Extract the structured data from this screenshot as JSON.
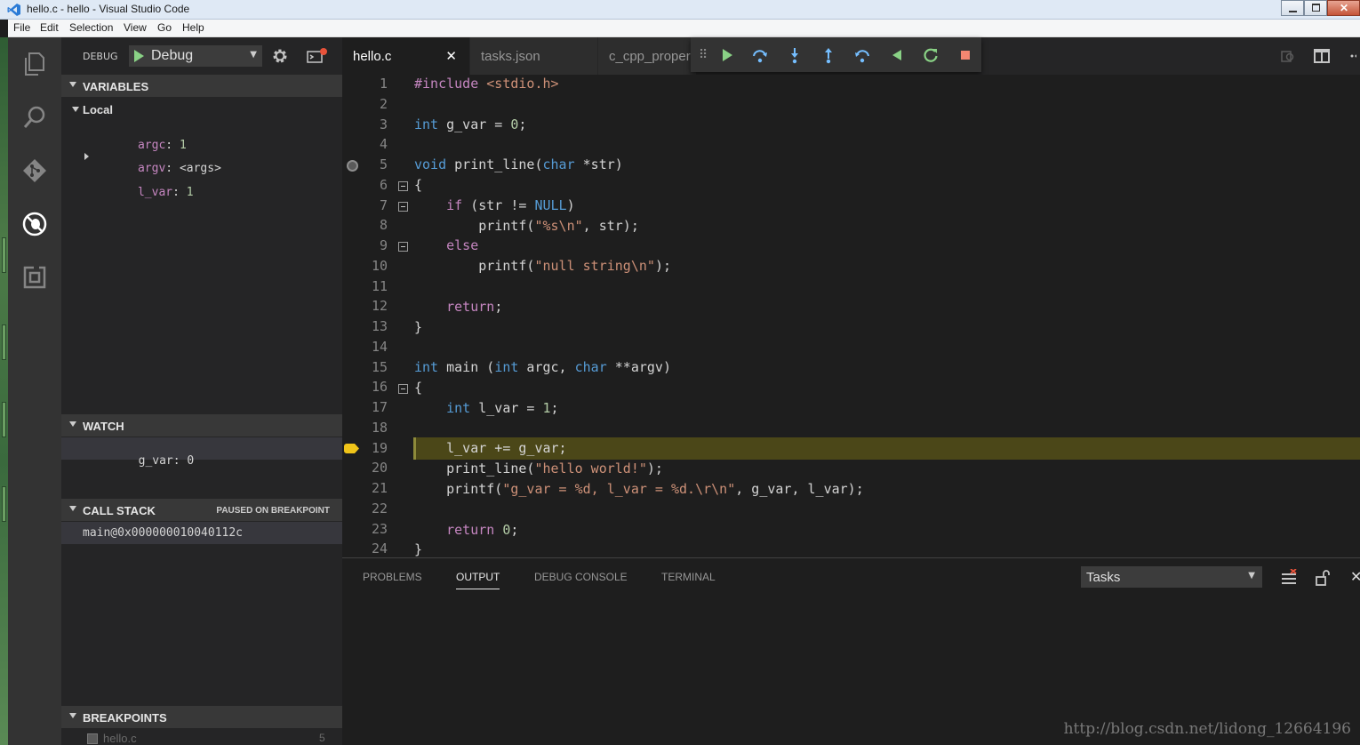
{
  "window": {
    "title": "hello.c - hello - Visual Studio Code"
  },
  "menu": [
    "File",
    "Edit",
    "Selection",
    "View",
    "Go",
    "Help"
  ],
  "activity_bar": [
    "files-icon",
    "search-icon",
    "git-icon",
    "debug-icon",
    "extensions-icon"
  ],
  "debug": {
    "label": "DEBUG",
    "config": "Debug"
  },
  "variables": {
    "title": "VARIABLES",
    "scope": "Local",
    "items": [
      {
        "name": "argc",
        "value": "1"
      },
      {
        "name": "argv",
        "value": "<args>"
      },
      {
        "name": "l_var",
        "value": "1"
      }
    ]
  },
  "watch": {
    "title": "WATCH",
    "items": [
      {
        "name": "g_var",
        "value": "0"
      }
    ]
  },
  "call_stack": {
    "title": "CALL STACK",
    "status": "PAUSED ON BREAKPOINT",
    "frames": [
      "main@0x000000010040112c"
    ]
  },
  "breakpoints": {
    "title": "BREAKPOINTS",
    "items": [
      {
        "file": "hello.c",
        "line": "5"
      }
    ]
  },
  "tabs": [
    {
      "label": "hello.c",
      "active": true
    },
    {
      "label": "tasks.json",
      "active": false
    },
    {
      "label": "c_cpp_proper",
      "active": false
    }
  ],
  "debug_toolbar": [
    "continue-icon",
    "step-over-icon",
    "step-into-icon",
    "step-out-icon",
    "step-back-icon",
    "reverse-continue-icon",
    "restart-icon",
    "stop-icon"
  ],
  "editor": {
    "current_line": 19,
    "breakpoint_line": 5,
    "lines": [
      {
        "n": "1"
      },
      {
        "n": "2"
      },
      {
        "n": "3"
      },
      {
        "n": "4"
      },
      {
        "n": "5"
      },
      {
        "n": "6"
      },
      {
        "n": "7"
      },
      {
        "n": "8"
      },
      {
        "n": "9"
      },
      {
        "n": "10"
      },
      {
        "n": "11"
      },
      {
        "n": "12"
      },
      {
        "n": "13"
      },
      {
        "n": "14"
      },
      {
        "n": "15"
      },
      {
        "n": "16"
      },
      {
        "n": "17"
      },
      {
        "n": "18"
      },
      {
        "n": "19"
      },
      {
        "n": "20"
      },
      {
        "n": "21"
      },
      {
        "n": "22"
      },
      {
        "n": "23"
      },
      {
        "n": "24"
      }
    ],
    "code": {
      "l1a": "#include",
      "l1b": " <stdio.h>",
      "l3a": "int",
      "l3b": " g_var = ",
      "l3c": "0",
      "l3d": ";",
      "l5a": "void",
      "l5b": " print_line(",
      "l5c": "char",
      "l5d": " *str)",
      "l6": "{",
      "l7a": "    if",
      "l7b": " (str != ",
      "l7c": "NULL",
      "l7d": ")",
      "l8a": "        printf(",
      "l8b": "\"%s\\n\"",
      "l8c": ", str);",
      "l9": "    else",
      "l10a": "        printf(",
      "l10b": "\"null string\\n\"",
      "l10c": ");",
      "l12a": "    return",
      "l12b": ";",
      "l13": "}",
      "l15a": "int",
      "l15b": " main (",
      "l15c": "int",
      "l15d": " argc, ",
      "l15e": "char",
      "l15f": " **argv)",
      "l16": "{",
      "l17a": "    int",
      "l17b": " l_var = ",
      "l17c": "1",
      "l17d": ";",
      "l19": "    l_var += g_var;",
      "l20a": "    print_line(",
      "l20b": "\"hello world!\"",
      "l20c": ");",
      "l21a": "    printf(",
      "l21b": "\"g_var = %d, l_var = %d.\\r\\n\"",
      "l21c": ", g_var, l_var);",
      "l23a": "    return",
      "l23b": " ",
      "l23c": "0",
      "l23d": ";",
      "l24": "}"
    }
  },
  "panel": {
    "tabs": [
      "PROBLEMS",
      "OUTPUT",
      "DEBUG CONSOLE",
      "TERMINAL"
    ],
    "active_tab": "OUTPUT",
    "task_select": "Tasks"
  },
  "watermark": "http://blog.csdn.net/lidong_12664196",
  "colors": {
    "current_line": "#4b4718",
    "breakpoint_paused": "#f0c419",
    "continue": "#89d185",
    "stop": "#f48771"
  }
}
